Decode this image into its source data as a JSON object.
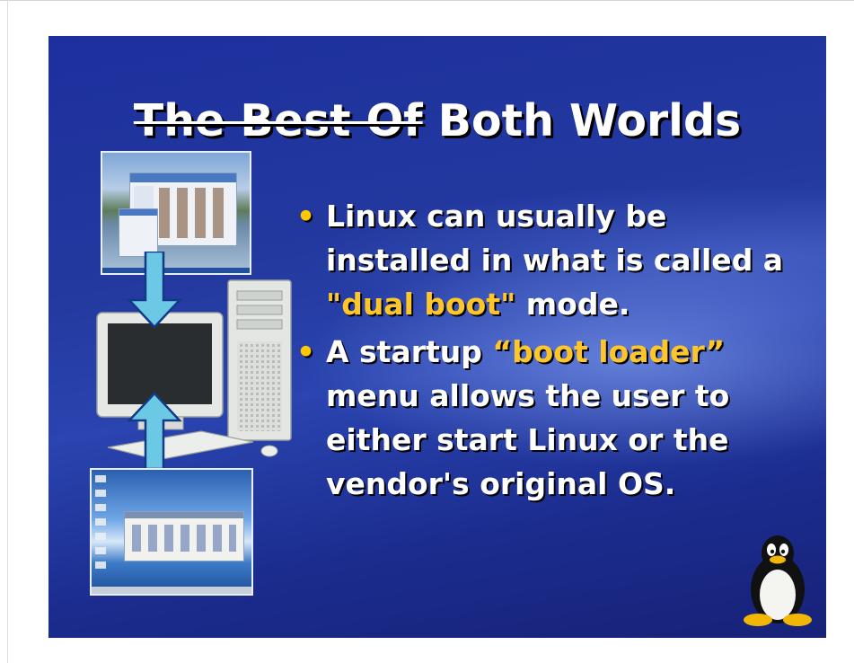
{
  "slide": {
    "title": {
      "struck": "The Best Of",
      "rest": " Both Worlds"
    },
    "bullets": [
      {
        "marker": "•",
        "before": "Linux can usually be installed in what is called a ",
        "highlight": "\"dual boot\"",
        "after": " mode."
      },
      {
        "marker": "•",
        "before": "A startup ",
        "highlight": "“boot loader”",
        "after": " menu allows the user to either start Linux or the vendor's original OS."
      }
    ],
    "colors": {
      "background": "#23399f",
      "highlight": "#ffc629",
      "text": "#ffffff"
    }
  }
}
